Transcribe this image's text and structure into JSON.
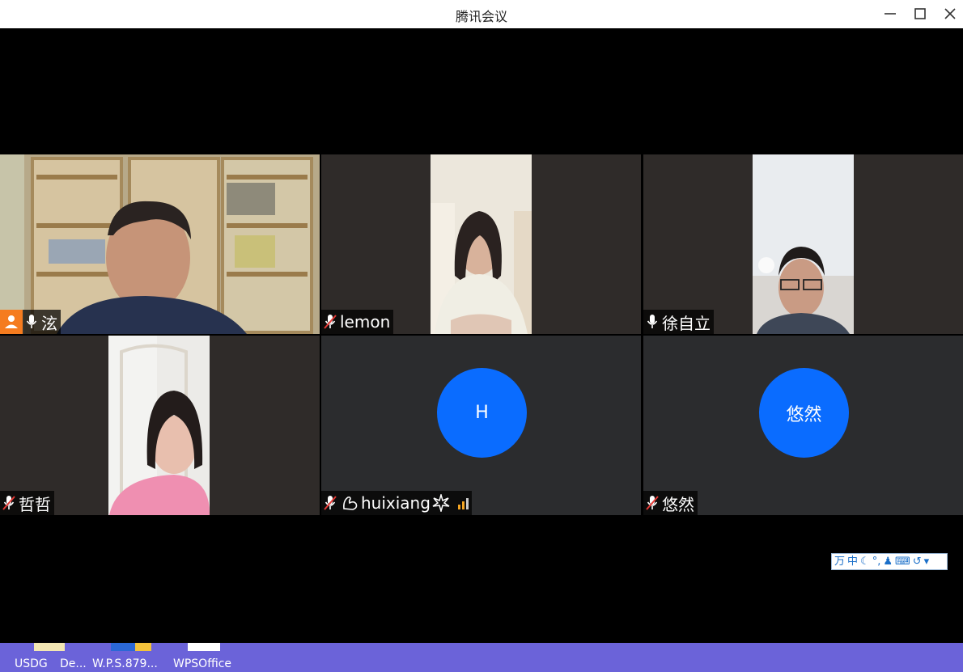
{
  "window": {
    "title": "腾讯会议"
  },
  "participants": [
    {
      "name": "泫",
      "host": true,
      "muted": false
    },
    {
      "name": "lemon",
      "host": false,
      "muted": true
    },
    {
      "name": "徐自立",
      "host": false,
      "muted": false
    },
    {
      "name": "哲哲",
      "host": false,
      "muted": true
    },
    {
      "name": "huixiang",
      "host": false,
      "muted": true,
      "avatar_text": "H"
    },
    {
      "name": "悠然",
      "host": false,
      "muted": true,
      "avatar_text": "悠然"
    }
  ],
  "ime_toolbar": {
    "mode": "中",
    "items": [
      "万",
      "中",
      "☾",
      "°,",
      "♟",
      "⌨",
      "↺",
      "▾"
    ]
  },
  "taskbar": {
    "items": [
      "USDG",
      "De...",
      "W.P.S.879...",
      "WPSOffice"
    ]
  },
  "colors": {
    "host_badge": "#f57c1f",
    "avatar": "#0a6cff",
    "mute_red": "#e53935",
    "taskbar": "#6b63d9",
    "signal": "#f5a623"
  }
}
